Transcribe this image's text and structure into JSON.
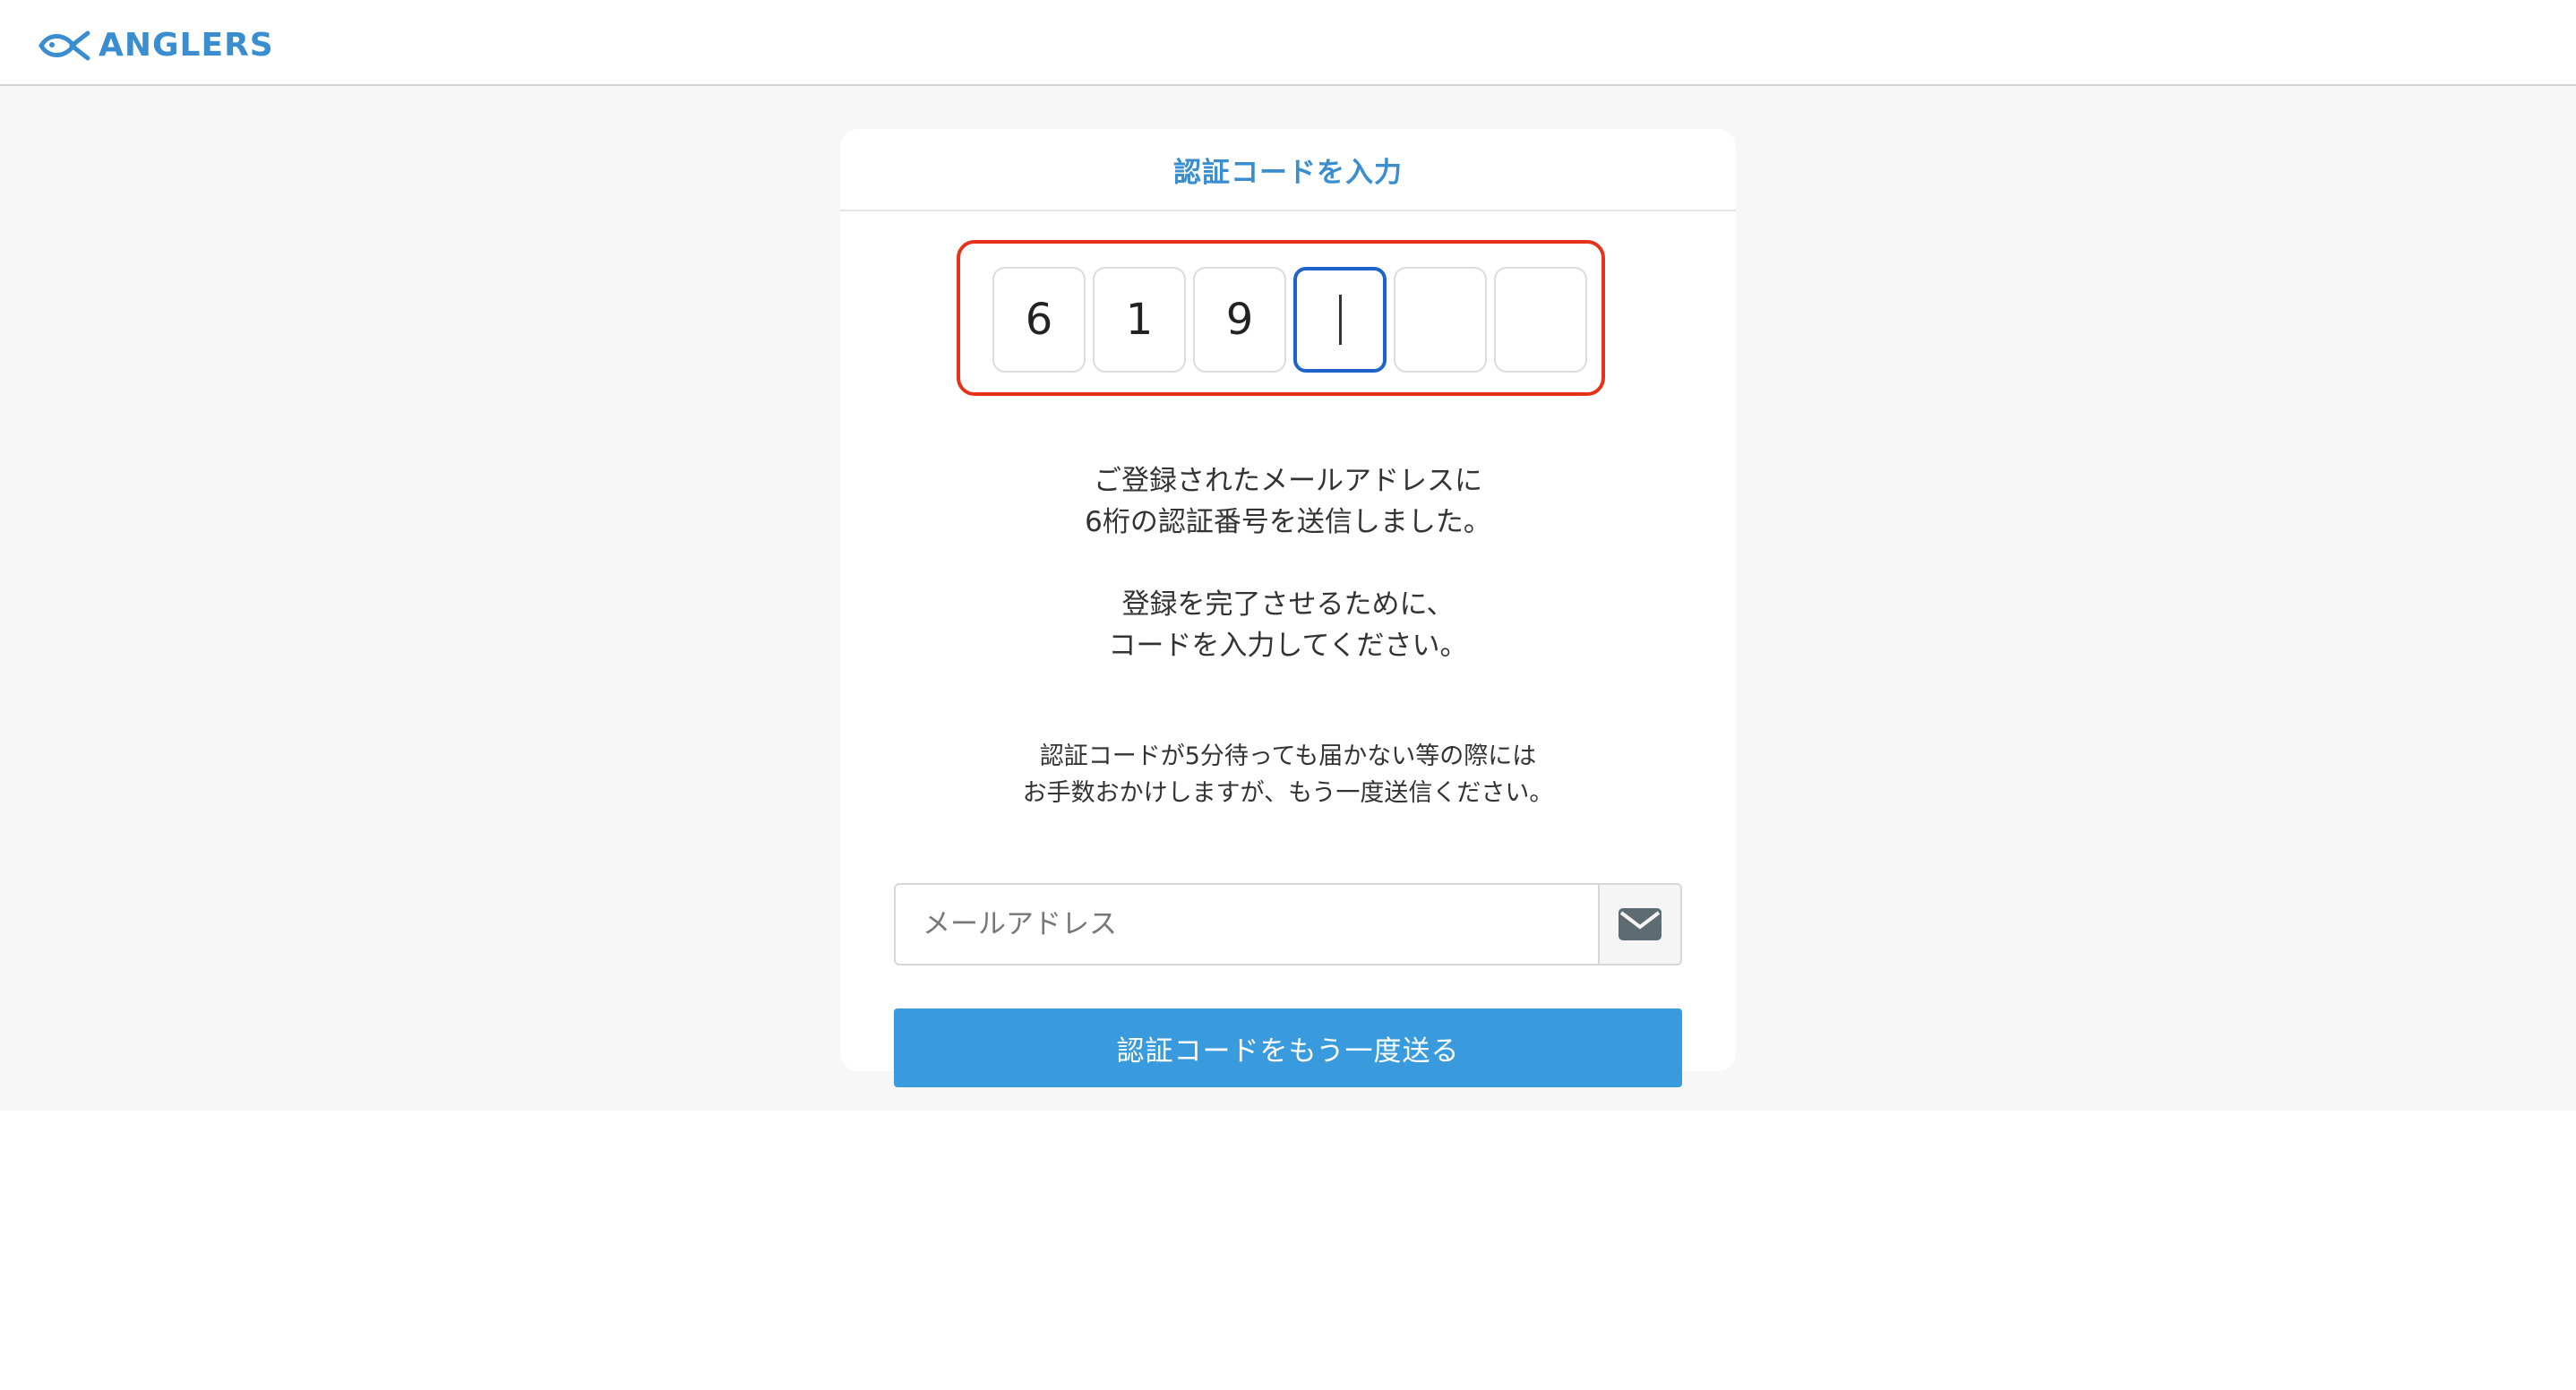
{
  "header": {
    "logo_text": "ANGLERS",
    "logo_icon": "fish-icon",
    "brand_color": "#3a8ed0"
  },
  "card": {
    "title": "認証コードを入力",
    "code_digits": [
      "6",
      "1",
      "9",
      "",
      "",
      ""
    ],
    "active_digit_index": 3,
    "message1_line1": "ご登録されたメールアドレスに",
    "message1_line2": "6桁の認証番号を送信しました。",
    "message2_line1": "登録を完了させるために、",
    "message2_line2": "コードを入力してください。",
    "note_line1": "認証コードが5分待っても届かない等の際には",
    "note_line2": "お手数おかけしますが、もう一度送信ください。",
    "email_placeholder": "メールアドレス",
    "email_icon": "envelope-icon",
    "resend_label": "認証コードをもう一度送る",
    "button_color": "#3a9ade",
    "highlight_color": "#e7321a"
  }
}
